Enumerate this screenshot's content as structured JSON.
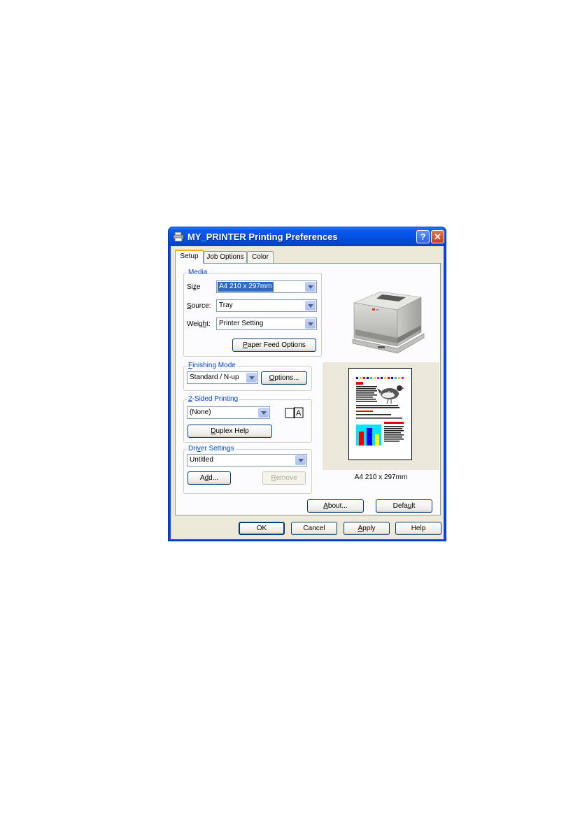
{
  "window": {
    "title": "MY_PRINTER Printing Preferences",
    "help_label": "?",
    "close_label": "✕"
  },
  "tabs": [
    {
      "label": "Setup",
      "active": true
    },
    {
      "label": "Job Options",
      "active": false
    },
    {
      "label": "Color",
      "active": false
    }
  ],
  "media": {
    "group_label": "Media",
    "size_label_pre": "Si",
    "size_label_u": "z",
    "size_label_post": "e",
    "size_value": "A4 210 x 297mm",
    "source_label_u": "S",
    "source_label_post": "ource:",
    "source_value": "Tray",
    "weight_label_pre": "Weig",
    "weight_label_u": "h",
    "weight_label_post": "t:",
    "weight_value": "Printer Setting",
    "paper_feed_u": "P",
    "paper_feed_post": "aper Feed Options"
  },
  "finishing": {
    "group_label_u": "F",
    "group_label_post": "inishing Mode",
    "value": "Standard / N-up",
    "options_u": "O",
    "options_post": "ptions..."
  },
  "duplex": {
    "group_label_u": "2",
    "group_label_post": "-Sided Printing",
    "value": "(None)",
    "help_u": "D",
    "help_post": "uplex Help",
    "icon_label": "A"
  },
  "driver": {
    "group_label_pre": "Dri",
    "group_label_u": "v",
    "group_label_post": "er Settings",
    "value": "Untitled",
    "add_pre": "A",
    "add_u": "d",
    "add_post": "d...",
    "remove_u": "R",
    "remove_post": "emove"
  },
  "preview": {
    "caption": "A4 210 x 297mm"
  },
  "panel_buttons": {
    "about_u": "A",
    "about_post": "bout...",
    "default_pre": "Defa",
    "default_u": "u",
    "default_post": "lt"
  },
  "dialog_buttons": {
    "ok": "OK",
    "cancel": "Cancel",
    "apply_u": "A",
    "apply_post": "pply",
    "help": "Help"
  }
}
